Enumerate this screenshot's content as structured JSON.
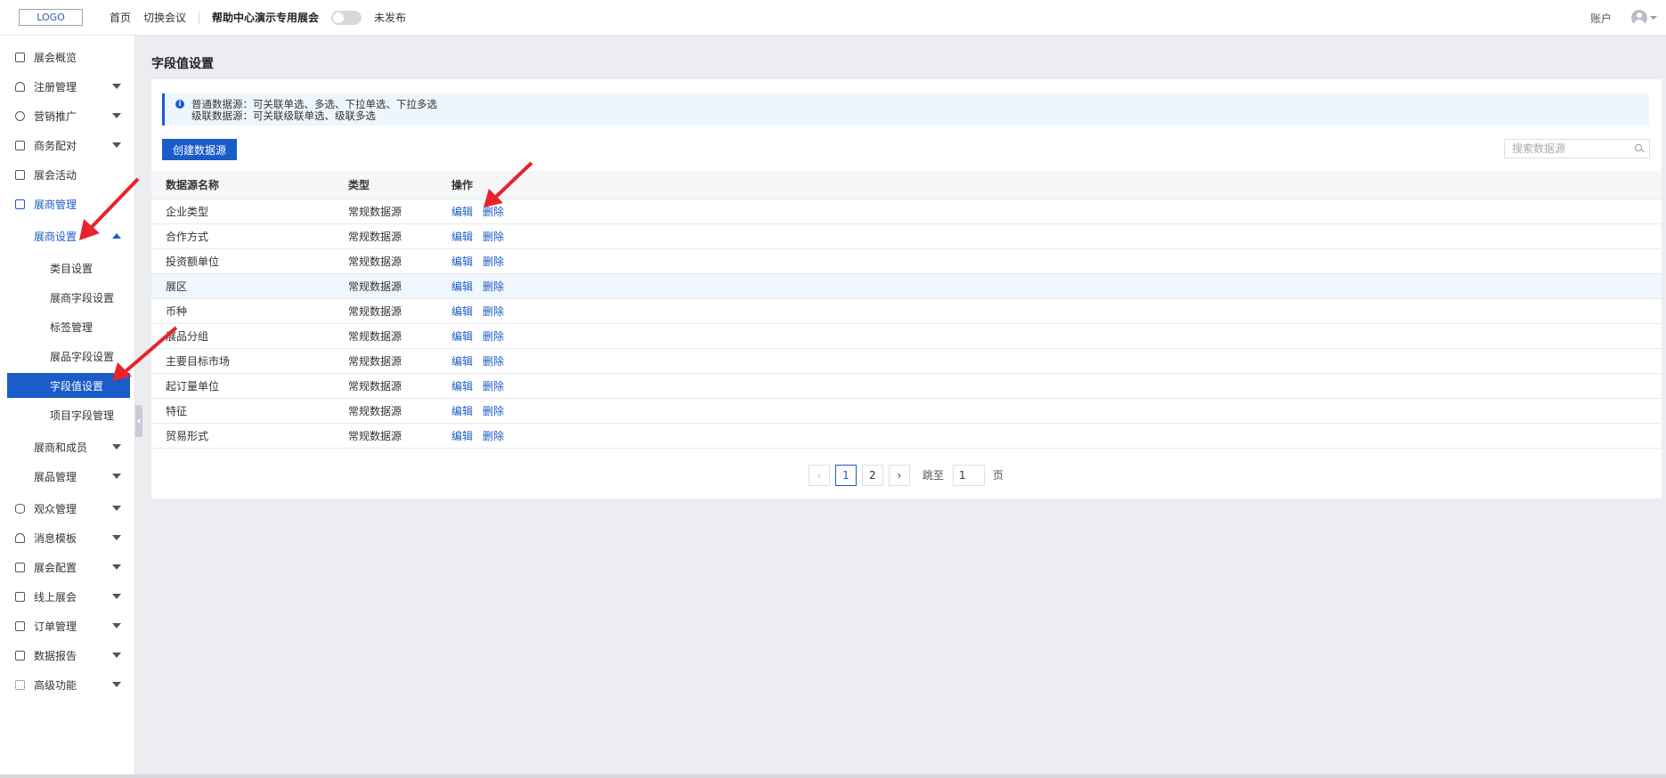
{
  "topbar": {
    "logo": "LOGO",
    "home": "首页",
    "switch_meeting": "切换会议",
    "event_title": "帮助中心演示专用展会",
    "publish_status": "未发布",
    "account": "账户"
  },
  "sidebar": {
    "items": [
      {
        "label": "展会概览",
        "icon": "overview-icon"
      },
      {
        "label": "注册管理",
        "icon": "user-icon"
      },
      {
        "label": "营销推广",
        "icon": "clock-icon"
      },
      {
        "label": "商务配对",
        "icon": "copy-icon"
      },
      {
        "label": "展会活动",
        "icon": "bookmark-icon"
      },
      {
        "label": "展商管理",
        "icon": "store-icon"
      },
      {
        "label": "展商设置"
      },
      {
        "label": "类目设置"
      },
      {
        "label": "展商字段设置"
      },
      {
        "label": "标签管理"
      },
      {
        "label": "展品字段设置"
      },
      {
        "label": "字段值设置"
      },
      {
        "label": "项目字段管理"
      },
      {
        "label": "展商和成员"
      },
      {
        "label": "展品管理"
      },
      {
        "label": "观众管理",
        "icon": "database-icon"
      },
      {
        "label": "消息模板",
        "icon": "bell-icon"
      },
      {
        "label": "展会配置",
        "icon": "config-icon"
      },
      {
        "label": "线上展会",
        "icon": "monitor-icon"
      },
      {
        "label": "订单管理",
        "icon": "order-icon"
      },
      {
        "label": "数据报告",
        "icon": "chart-icon"
      },
      {
        "label": "高级功能",
        "icon": "grid-icon"
      }
    ]
  },
  "page": {
    "title": "字段值设置",
    "notice_line1": "普通数据源：可关联单选、多选、下拉单选、下拉多选",
    "notice_line2": "级联数据源：可关联级联单选、级联多选",
    "create_button": "创建数据源",
    "search_placeholder": "搜索数据源"
  },
  "table": {
    "columns": [
      "数据源名称",
      "类型",
      "操作"
    ],
    "rows": [
      {
        "name": "企业类型",
        "type": "常规数据源"
      },
      {
        "name": "合作方式",
        "type": "常规数据源"
      },
      {
        "name": "投资额单位",
        "type": "常规数据源"
      },
      {
        "name": "展区",
        "type": "常规数据源"
      },
      {
        "name": "币种",
        "type": "常规数据源"
      },
      {
        "name": "展品分组",
        "type": "常规数据源"
      },
      {
        "name": "主要目标市场",
        "type": "常规数据源"
      },
      {
        "name": "起订量单位",
        "type": "常规数据源"
      },
      {
        "name": "特征",
        "type": "常规数据源"
      },
      {
        "name": "贸易形式",
        "type": "常规数据源"
      }
    ],
    "edit_label": "编辑",
    "delete_label": "删除"
  },
  "pagination": {
    "prev": "‹",
    "pages": [
      "1",
      "2"
    ],
    "next": "›",
    "jump_label": "跳至",
    "jump_value": "1",
    "page_unit": "页"
  },
  "colors": {
    "primary": "#1a5cc8",
    "annotation_arrow": "#e8232b"
  }
}
